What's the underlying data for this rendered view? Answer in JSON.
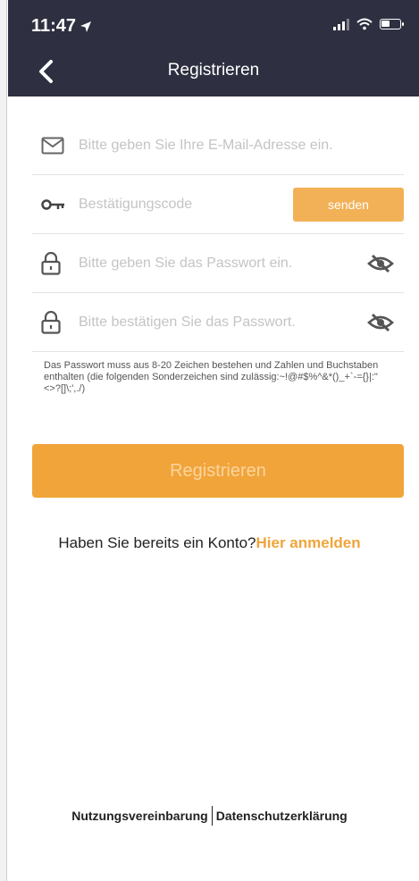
{
  "status": {
    "time": "11:47"
  },
  "nav": {
    "title": "Registrieren"
  },
  "form": {
    "email_placeholder": "Bitte geben Sie Ihre E-Mail-Adresse ein.",
    "code_placeholder": "Bestätigungscode",
    "send_label": "senden",
    "password_placeholder": "Bitte geben Sie das Passwort ein.",
    "confirm_placeholder": "Bitte bestätigen Sie das Passwort.",
    "hint": "Das Passwort muss aus 8-20 Zeichen bestehen und Zahlen und Buchstaben enthalten (die folgenden Sonderzeichen sind zulässig:~!@#$%^&*()_+`-={}|:\"<>?[]\\;',./)",
    "register_label": "Registrieren"
  },
  "login": {
    "question": "Haben Sie bereits ein Konto?",
    "link": "Hier anmelden"
  },
  "footer": {
    "terms": "Nutzungsvereinbarung",
    "privacy": "Datenschutzerklärung"
  },
  "colors": {
    "header": "#2e3041",
    "accent": "#f0a43a"
  },
  "icons": {
    "email": "envelope-icon",
    "code": "key-icon",
    "password": "lock-icon",
    "visibility": "eye-off-icon",
    "back": "chevron-left-icon"
  }
}
